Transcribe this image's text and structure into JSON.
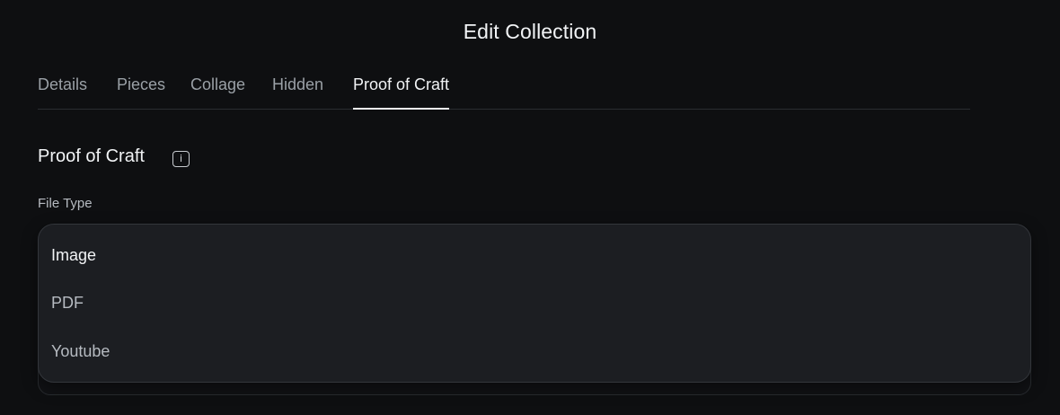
{
  "header": {
    "title": "Edit Collection"
  },
  "tabs": [
    {
      "label": "Details",
      "active": false
    },
    {
      "label": "Pieces",
      "active": false
    },
    {
      "label": "Collage",
      "active": false
    },
    {
      "label": "Hidden",
      "active": false
    },
    {
      "label": "Proof of Craft",
      "active": true
    }
  ],
  "section": {
    "title": "Proof of Craft",
    "info_icon_glyph": "i",
    "info_icon": "info-icon"
  },
  "file_type": {
    "label": "File Type",
    "options": [
      {
        "label": "Image",
        "highlighted": true
      },
      {
        "label": "PDF",
        "highlighted": false
      },
      {
        "label": "Youtube",
        "highlighted": false
      }
    ]
  },
  "colors": {
    "background": "#0e0f11",
    "dropdown_bg": "#1c1e22",
    "active_text": "#f1f3f5",
    "muted_text": "#9aa0a6"
  }
}
